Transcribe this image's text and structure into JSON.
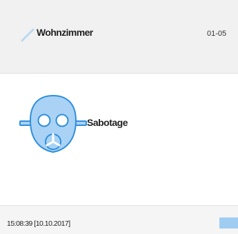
{
  "header": {
    "room_name": "Wohnzimmer",
    "room_id": "01-05",
    "edit_icon": "pencil-icon"
  },
  "event": {
    "icon": "gas-mask-icon",
    "label": "Sabotage"
  },
  "footer": {
    "timestamp": "15:08:39 [10.10.2017]",
    "status_color": "#9fcdf2"
  },
  "colors": {
    "icon_fill": "#a9d2f5",
    "icon_stroke": "#2f8fdc",
    "header_bg": "#f1f1f1"
  }
}
